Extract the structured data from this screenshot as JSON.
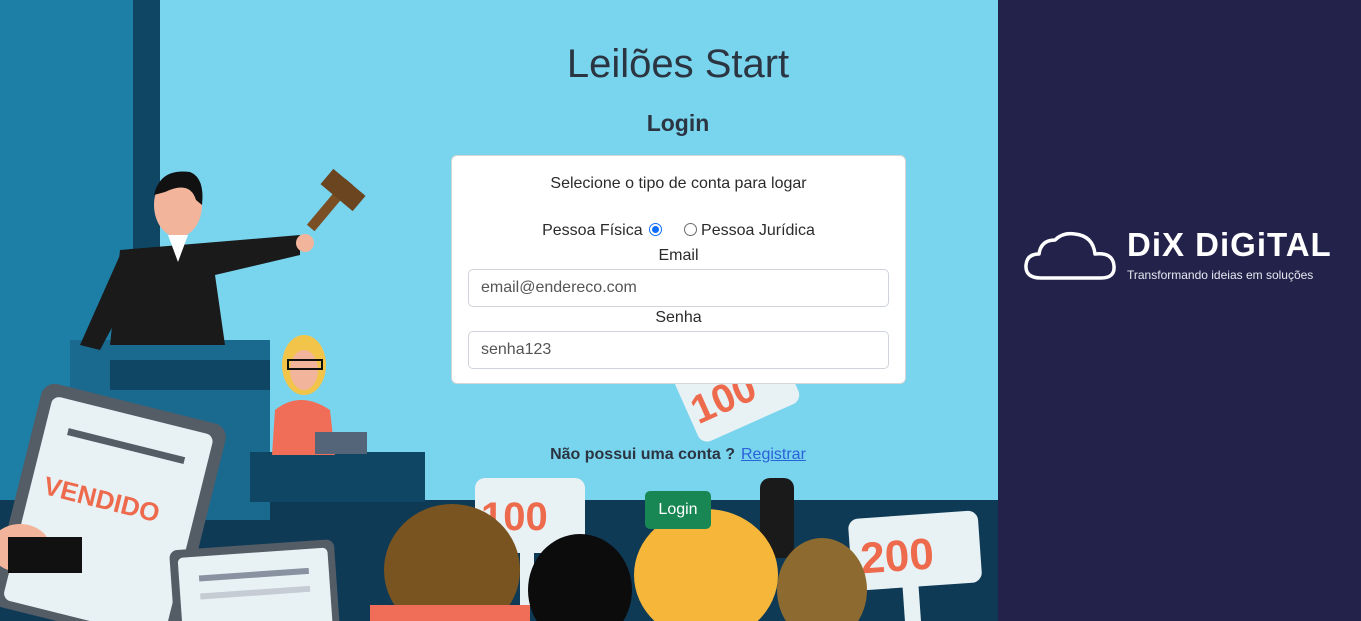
{
  "page": {
    "title": "Leilões Start",
    "subtitle": "Login"
  },
  "login_card": {
    "prompt": "Selecione o tipo de conta para logar",
    "account_types": [
      {
        "label": "Pessoa Física",
        "selected": true
      },
      {
        "label": "Pessoa Jurídica",
        "selected": false
      }
    ],
    "email_label": "Email",
    "email_value": "email@endereco.com",
    "password_label": "Senha",
    "password_value": "senha123"
  },
  "signup": {
    "question": "Não possui uma conta ?",
    "link": "Registrar"
  },
  "login_button": "Login",
  "illustration": {
    "sign_sold": "VENDIDO",
    "paddle_1": "100",
    "paddle_2": "200",
    "paddle_3": "100"
  },
  "brand": {
    "name": "DiX DiGiTAL",
    "tagline": "Transformando ideias em soluções",
    "icon": "cloud-icon"
  },
  "colors": {
    "sky": "#79d4ee",
    "brand_bg": "#23224a",
    "login_button": "#198754",
    "link": "#2a62d9"
  }
}
